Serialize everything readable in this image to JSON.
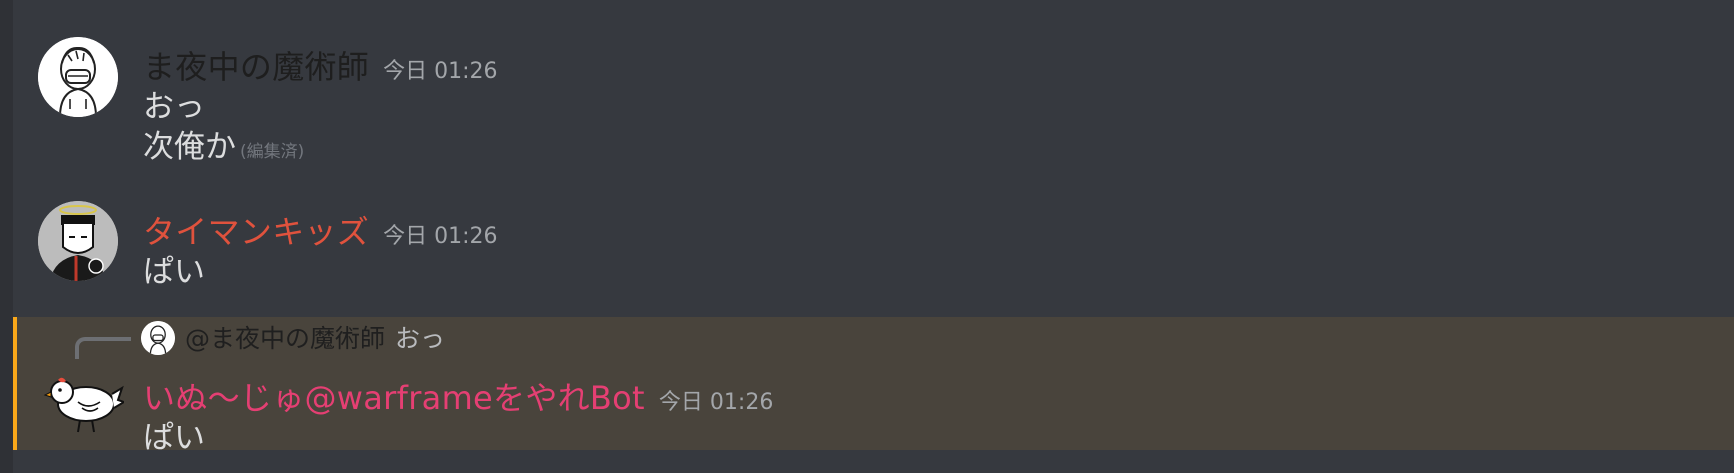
{
  "messages": [
    {
      "author": "ま夜中の魔術師",
      "author_color": "#1e1e1e",
      "timestamp": "今日 01:26",
      "lines": [
        "おっ",
        "次俺か"
      ],
      "edited_label": "(編集済)"
    },
    {
      "author": "タイマンキッズ",
      "author_color": "#e0523d",
      "timestamp": "今日 01:26",
      "lines": [
        "ぱい"
      ]
    },
    {
      "reply": {
        "author": "@ま夜中の魔術師",
        "content": "おっ"
      },
      "author": "いぬ〜じゅ@warframeをやれBot",
      "author_color": "#e53f73",
      "timestamp": "今日 01:26",
      "lines": [
        "ぱい"
      ],
      "highlight_color": "#faa81a"
    }
  ]
}
